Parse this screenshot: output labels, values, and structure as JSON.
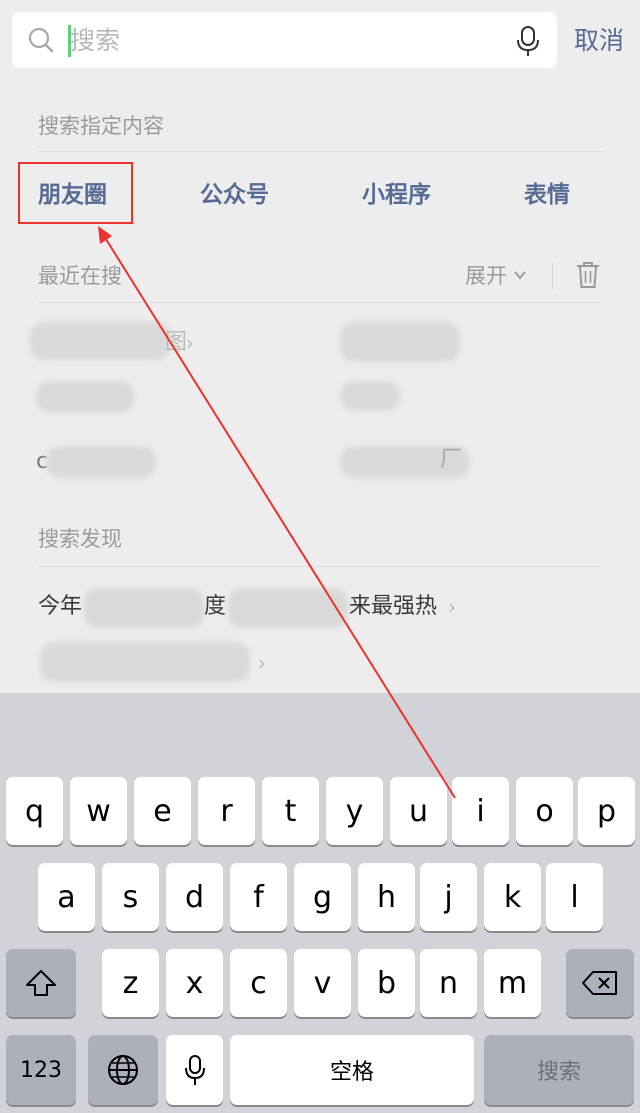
{
  "search": {
    "placeholder": "搜索",
    "cancel_label": "取消"
  },
  "specified": {
    "title": "搜索指定内容",
    "categories": [
      "朋友圈",
      "公众号",
      "小程序",
      "表情"
    ]
  },
  "recent": {
    "title": "最近在搜",
    "expand_label": "展开",
    "items": [
      {
        "visible_text": "图",
        "chevron": "›"
      },
      {
        "visible_text": ""
      },
      {
        "visible_text": ""
      },
      {
        "visible_text": ""
      },
      {
        "visible_text": "c"
      },
      {
        "visible_text": "厂"
      }
    ]
  },
  "discover": {
    "title": "搜索发现",
    "line1": {
      "part1": "今年",
      "part2": "度",
      "part3": "来最强热",
      "chevron": "›"
    },
    "line2": {
      "chevron": "›"
    }
  },
  "keyboard": {
    "row1": [
      "q",
      "w",
      "e",
      "r",
      "t",
      "y",
      "u",
      "i",
      "o",
      "p"
    ],
    "row2": [
      "a",
      "s",
      "d",
      "f",
      "g",
      "h",
      "j",
      "k",
      "l"
    ],
    "row3": [
      "z",
      "x",
      "c",
      "v",
      "b",
      "n",
      "m"
    ],
    "numbers_label": "123",
    "space_label": "空格",
    "search_label": "搜索"
  },
  "colors": {
    "link": "#576b95",
    "highlight": "#e8332f",
    "caret": "#5fcf7d"
  }
}
